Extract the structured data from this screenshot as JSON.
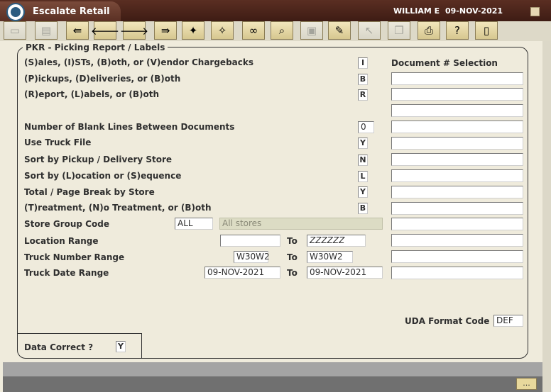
{
  "app": {
    "title": "Escalate Retail",
    "user": "WILLIAM E",
    "date": "09-NOV-2021"
  },
  "toolbar": [
    {
      "icon": "new-record-icon",
      "glyph": "▭",
      "disabled": true
    },
    {
      "icon": "duplicate-record-icon",
      "glyph": "▤",
      "disabled": true
    },
    {
      "icon": "previous-block-icon",
      "glyph": "⇚",
      "disabled": false
    },
    {
      "icon": "previous-record-arrow-icon",
      "glyph": "🡐",
      "disabled": false
    },
    {
      "icon": "next-record-arrow-icon",
      "glyph": "🡒",
      "disabled": false
    },
    {
      "icon": "next-block-icon",
      "glyph": "⇛",
      "disabled": false
    },
    {
      "icon": "calendar-star-icon",
      "glyph": "✦",
      "disabled": false
    },
    {
      "icon": "calendar-star-alt-icon",
      "glyph": "✧",
      "disabled": false
    },
    {
      "icon": "binoculars-icon",
      "glyph": "∞",
      "disabled": false
    },
    {
      "icon": "zoom-icon",
      "glyph": "⌕",
      "disabled": false
    },
    {
      "icon": "save-icon",
      "glyph": "▣",
      "disabled": true
    },
    {
      "icon": "edit-icon",
      "glyph": "✎",
      "disabled": false
    },
    {
      "icon": "pointer-icon",
      "glyph": "↖",
      "disabled": true
    },
    {
      "icon": "stack-icon",
      "glyph": "❐",
      "disabled": true
    },
    {
      "icon": "print-icon",
      "glyph": "⎙",
      "disabled": false
    },
    {
      "icon": "help-icon",
      "glyph": "?",
      "disabled": false
    },
    {
      "icon": "exit-icon",
      "glyph": "▯",
      "disabled": false
    }
  ],
  "form": {
    "title": "PKR - Picking Report / Labels",
    "doc_header": "Document # Selection",
    "rows": {
      "sales_type": {
        "label": "(S)ales, (I)STs, (B)oth, or (V)endor Chargebacks",
        "value": "I"
      },
      "pickup_delivery": {
        "label": "(P)ickups, (D)eliveries, or (B)oth",
        "value": "B"
      },
      "report_labels": {
        "label": "(R)eport, (L)abels, or (B)oth",
        "value": "R"
      },
      "blank_lines": {
        "label": "Number of Blank Lines Between Documents",
        "value": "0"
      },
      "use_truck_file": {
        "label": "Use Truck File",
        "value": "Y"
      },
      "sort_store": {
        "label": "Sort by Pickup / Delivery Store",
        "value": "N"
      },
      "sort_location": {
        "label": "Sort by (L)ocation or (S)equence",
        "value": "L"
      },
      "page_break": {
        "label": "Total / Page Break by Store",
        "value": "Y"
      },
      "treatment": {
        "label": "(T)reatment, (N)o Treatment, or (B)oth",
        "value": "B"
      }
    },
    "store_group": {
      "label": "Store Group Code",
      "code": "ALL",
      "description": "All stores"
    },
    "location_range": {
      "label": "Location Range",
      "from": "",
      "to_label": "To",
      "to": "ZZZZZZ"
    },
    "truck_number_range": {
      "label": "Truck Number Range",
      "from": "W30W2",
      "to_label": "To",
      "to": "W30W2"
    },
    "truck_date_range": {
      "label": "Truck Date Range",
      "from": "09-NOV-2021",
      "to_label": "To",
      "to": "09-NOV-2021"
    },
    "uda": {
      "label": "UDA Format Code",
      "value": "DEF"
    },
    "data_correct": {
      "label": "Data Correct ?",
      "value": "Y"
    }
  },
  "statusbar": {
    "button_label": "..."
  }
}
